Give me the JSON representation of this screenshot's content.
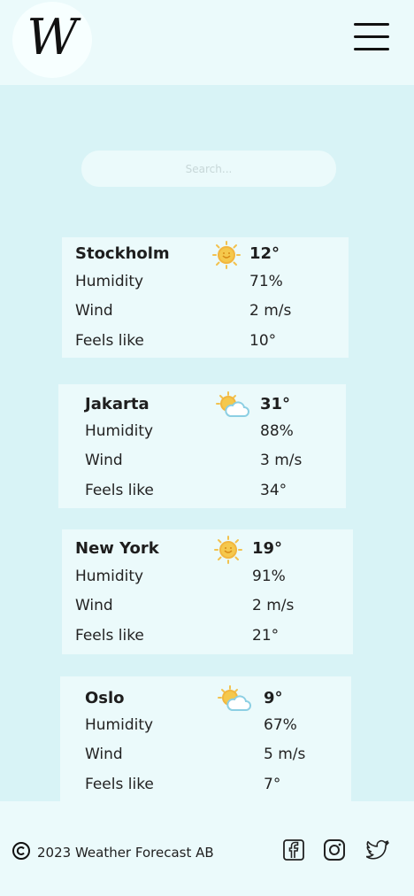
{
  "header": {
    "logo_text": "W",
    "menu_icon": "hamburger-menu-icon"
  },
  "search": {
    "placeholder": "Search..."
  },
  "cards": [
    {
      "city": "Stockholm",
      "temp": "12°",
      "icon": "sun-icon",
      "humidity_label": "Humidity",
      "humidity": "71%",
      "wind_label": "Wind",
      "wind": "2 m/s",
      "feels_label": "Feels like",
      "feels": "10°"
    },
    {
      "city": "Jakarta",
      "temp": "31°",
      "icon": "partly-cloudy-icon",
      "humidity_label": "Humidity",
      "humidity": "88%",
      "wind_label": "Wind",
      "wind": "3 m/s",
      "feels_label": "Feels like",
      "feels": "34°"
    },
    {
      "city": "New York",
      "temp": "19°",
      "icon": "sun-icon",
      "humidity_label": "Humidity",
      "humidity": "91%",
      "wind_label": "Wind",
      "wind": "2 m/s",
      "feels_label": "Feels like",
      "feels": "21°"
    },
    {
      "city": "Oslo",
      "temp": "9°",
      "icon": "partly-cloudy-icon",
      "humidity_label": "Humidity",
      "humidity": "67%",
      "wind_label": "Wind",
      "wind": "5 m/s",
      "feels_label": "Feels like",
      "feels": "7°"
    }
  ],
  "footer": {
    "copyright": "2023 Weather Forecast AB",
    "social": [
      "facebook-icon",
      "instagram-icon",
      "twitter-icon"
    ]
  },
  "colors": {
    "page_background": "#d8f3f6",
    "card_background": "#ebfafb",
    "sun_yellow": "#f5c84c",
    "cloud_blue": "#8ccfe3"
  }
}
